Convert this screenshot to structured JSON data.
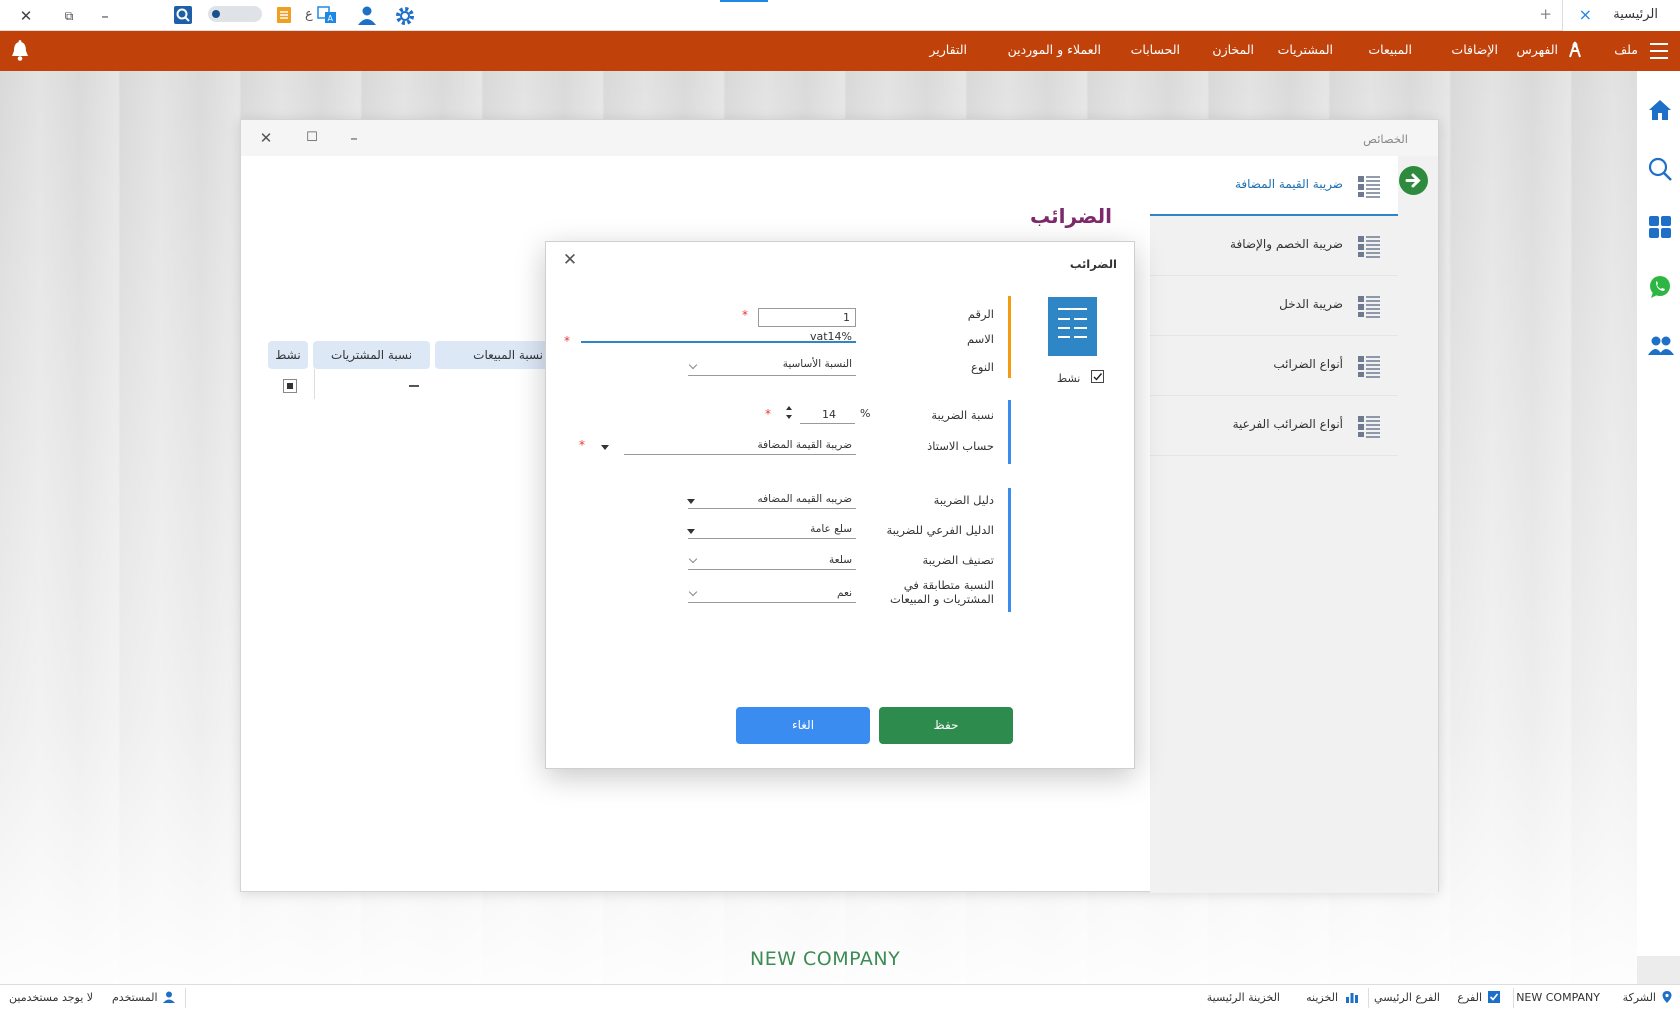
{
  "titlebar": {
    "tab_home": "الرئيسية",
    "tab_home_close": "×",
    "tab_new": "+",
    "close": "✕",
    "restore": "⧉",
    "minimize": "–",
    "lang_letter": "ع"
  },
  "menu": {
    "items": [
      "ملف",
      "الفهرس",
      "الإضافات",
      "المبيعات",
      "المشتريات",
      "المخازن",
      "الحسابات",
      "العملاء و الموردين",
      "التقارير"
    ]
  },
  "props_window": {
    "title": "الخصائص",
    "close": "✕",
    "maximize": "☐",
    "minimize": "–",
    "heading": "الضرائب",
    "nav_items": [
      {
        "label": "ضريبة القيمة المضافة",
        "active": true
      },
      {
        "label": "ضريبة الخصم والإضافة",
        "active": false
      },
      {
        "label": "ضريبة الدخل",
        "active": false
      },
      {
        "label": "أنواع الضرائب",
        "active": false
      },
      {
        "label": "أنواع الضرائب الفرعية",
        "active": false
      }
    ],
    "grid": {
      "columns": [
        "نشط",
        "نسبة المشتريات",
        "نسبة المبيعات"
      ]
    }
  },
  "dialog": {
    "title": "الضرائب",
    "close": "✕",
    "active_label": "نشط",
    "active_checked": true,
    "required_mark": "*",
    "fields": {
      "number": {
        "label": "الرقم",
        "value": "1"
      },
      "name": {
        "label": "الاسم",
        "value": "vat14%"
      },
      "type": {
        "label": "النوع",
        "value": "النسبة الأساسية"
      },
      "rate": {
        "label": "نسبة الضريبة",
        "value": "14",
        "unit": "%"
      },
      "ledger": {
        "label": "حساب الاستاذ",
        "value": "ضريبة القيمة المضافة"
      },
      "tax_guide": {
        "label": "دليل الضريبة",
        "value": "ضريبه القيمه المضافه"
      },
      "sub_guide": {
        "label": "الدليل الفرعي للضريبة",
        "value": "سلع عامة"
      },
      "classification": {
        "label": "تصنيف الضريبة",
        "value": "سلعة"
      },
      "matching": {
        "label_line1": "النسبة متطابقة في",
        "label_line2": "المشتريات و المبيعات",
        "value": "نعم"
      }
    },
    "save_label": "حفظ",
    "cancel_label": "الغاء"
  },
  "desktop": {
    "company_name": "NEW COMPANY"
  },
  "statusbar": {
    "company_label": "الشركة",
    "company_value": "NEW COMPANY",
    "branch_label": "الفرع",
    "branch_value": "الفرع الرئيسي",
    "treasury_label": "الخزينه",
    "treasury_value": "الخزينة الرئيسية",
    "user_label": "المستخدم",
    "user_value": "لا يوجد مستخدمين"
  },
  "colors": {
    "menubar": "#c0410a",
    "accent_blue": "#2f86c6",
    "save_green": "#2e8b4e",
    "cancel_blue": "#3b8cf0",
    "orange_bar": "#f39c12",
    "heading_purple": "#7d2a6c"
  }
}
